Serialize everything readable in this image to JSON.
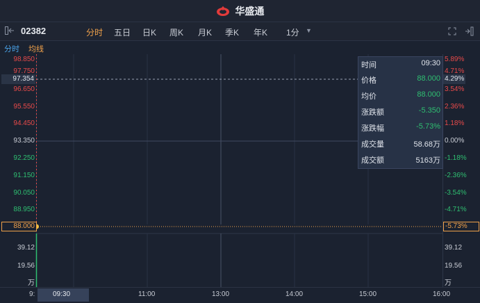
{
  "brand": {
    "name": "华盛通",
    "logo_icon": "flame-logo-icon"
  },
  "toolbar": {
    "ticker": "02382",
    "tabs": [
      {
        "label": "分时",
        "active": true
      },
      {
        "label": "五日",
        "active": false
      },
      {
        "label": "日K",
        "active": false
      },
      {
        "label": "周K",
        "active": false
      },
      {
        "label": "月K",
        "active": false
      },
      {
        "label": "季K",
        "active": false
      },
      {
        "label": "年K",
        "active": false
      }
    ],
    "interval": "1分"
  },
  "legend": {
    "timeshare": "分时",
    "average": "均线"
  },
  "axes": {
    "price_left": [
      "98.850",
      "97.750",
      "96.650",
      "95.550",
      "94.450",
      "93.350",
      "92.250",
      "91.150",
      "90.050",
      "88.950"
    ],
    "pct_right": [
      "5.89%",
      "4.71%",
      "3.54%",
      "2.36%",
      "1.18%",
      "0.00%",
      "-1.18%",
      "-2.36%",
      "-3.54%",
      "-4.71%"
    ],
    "volume_left": [
      "39.12",
      "19.56",
      "万"
    ],
    "volume_right": [
      "39.12",
      "19.56",
      "万"
    ],
    "x_labels": [
      "9:",
      "09:30",
      "11:00",
      "13:00",
      "14:00",
      "15:00",
      "16:00"
    ]
  },
  "crosshair": {
    "price_tag": "97.354",
    "pct_tag": "4.29%",
    "current_price_tag": "88.000",
    "current_pct_tag": "-5.73%"
  },
  "info": {
    "rows": [
      {
        "key": "时间",
        "value": "09:30",
        "color": "#dfe3ea"
      },
      {
        "key": "价格",
        "value": "88.000",
        "color": "#2fbf71"
      },
      {
        "key": "均价",
        "value": "88.000",
        "color": "#2fbf71"
      },
      {
        "key": "涨跌额",
        "value": "-5.350",
        "color": "#2fbf71"
      },
      {
        "key": "涨跌幅",
        "value": "-5.73%",
        "color": "#2fbf71"
      },
      {
        "key": "成交量",
        "value": "58.68万",
        "color": "#dfe3ea"
      },
      {
        "key": "成交额",
        "value": "5163万",
        "color": "#dfe3ea"
      }
    ]
  },
  "colors": {
    "up": "#e84a4a",
    "down": "#2fbf71",
    "accent": "#f0a14a",
    "blue": "#4aa3e8"
  }
}
